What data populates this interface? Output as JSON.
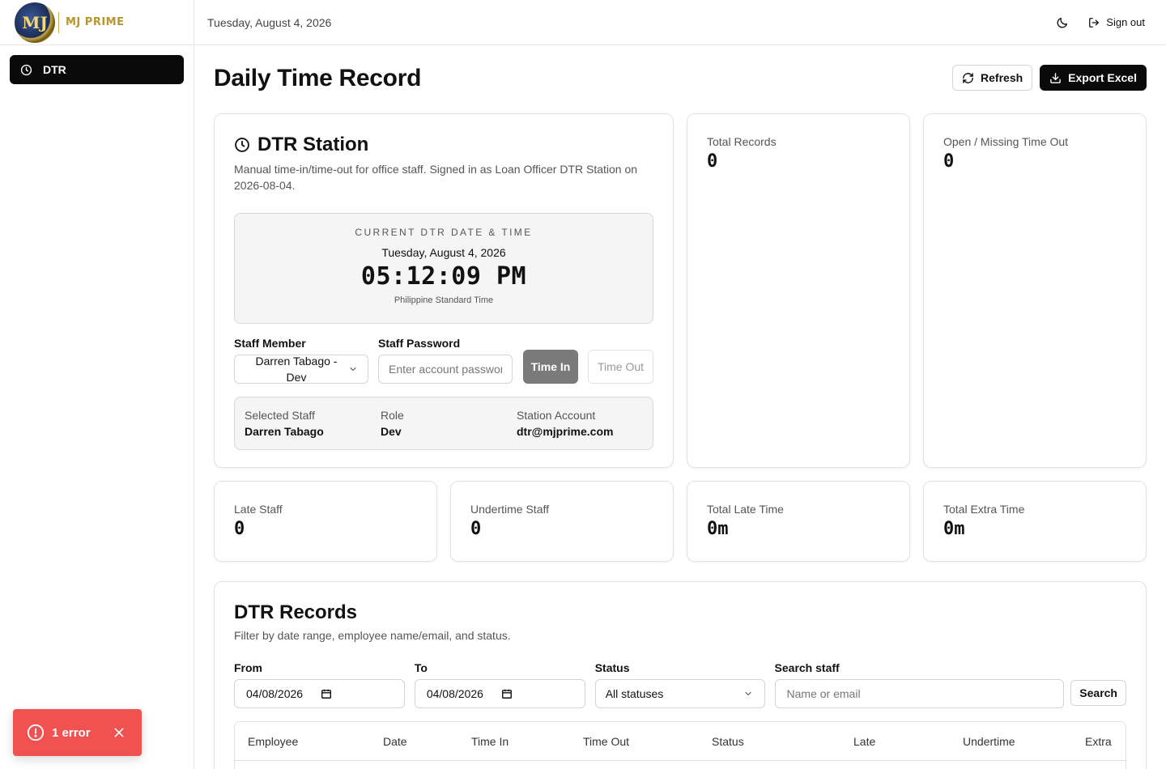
{
  "brand": {
    "logo_text": "MJ",
    "name": "MJ PRIME",
    "brand_color": "#b8962e"
  },
  "sidebar": {
    "items": [
      {
        "label": "DTR",
        "icon": "clock-icon"
      }
    ]
  },
  "topbar": {
    "date": "Tuesday, August 4, 2026",
    "theme_icon": "moon-icon",
    "sign_out": "Sign out"
  },
  "page": {
    "title": "Daily Time Record",
    "refresh_label": "Refresh",
    "export_label": "Export Excel"
  },
  "station": {
    "title": "DTR Station",
    "description": "Manual time-in/time-out for office staff. Signed in as Loan Officer DTR Station on 2026-08-04.",
    "clock": {
      "caption": "CURRENT DTR DATE & TIME",
      "date": "Tuesday, August 4, 2026",
      "time": "05:12:09 PM",
      "timezone": "Philippine Standard Time"
    },
    "staff_label": "Staff Member",
    "staff_value": "Darren Tabago - Dev",
    "password_label": "Staff Password",
    "password_placeholder": "Enter account password",
    "time_in_label": "Time In",
    "time_out_label": "Time Out",
    "info": {
      "selected_staff_label": "Selected Staff",
      "selected_staff_value": "Darren Tabago",
      "role_label": "Role",
      "role_value": "Dev",
      "station_account_label": "Station Account",
      "station_account_value": "dtr@mjprime.com"
    }
  },
  "stats": {
    "total_records": {
      "label": "Total Records",
      "value": "0"
    },
    "open_missing": {
      "label": "Open / Missing Time Out",
      "value": "0"
    },
    "late_staff": {
      "label": "Late Staff",
      "value": "0"
    },
    "undertime_staff": {
      "label": "Undertime Staff",
      "value": "0"
    },
    "total_late": {
      "label": "Total Late Time",
      "value": "0m"
    },
    "total_extra": {
      "label": "Total Extra Time",
      "value": "0m"
    }
  },
  "records": {
    "title": "DTR Records",
    "description": "Filter by date range, employee name/email, and status.",
    "from_label": "From",
    "from_value": "04/08/2026",
    "to_label": "To",
    "to_value": "04/08/2026",
    "status_label": "Status",
    "status_value": "All statuses",
    "search_label": "Search staff",
    "search_placeholder": "Name or email",
    "search_button": "Search",
    "columns": [
      "Employee",
      "Date",
      "Time In",
      "Time Out",
      "Status",
      "Late",
      "Undertime",
      "Extra"
    ]
  },
  "toast": {
    "message": "1 error",
    "color": "#f05252"
  }
}
